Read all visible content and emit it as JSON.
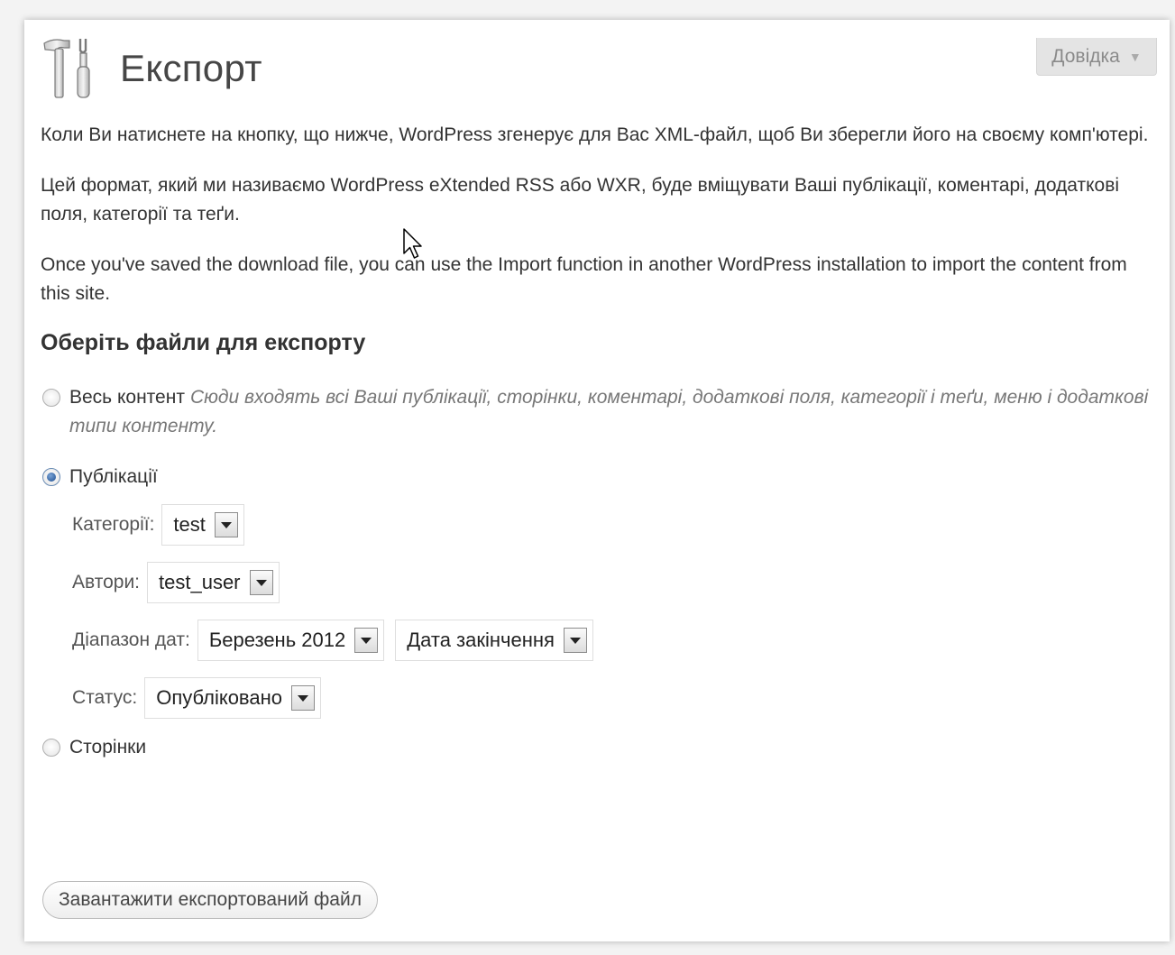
{
  "help_tab": {
    "label": "Довідка",
    "arrow": "▼"
  },
  "page": {
    "title": "Експорт",
    "icon": "tools-icon"
  },
  "intro": [
    "Коли Ви натиснете на кнопку, що нижче, WordPress згенерує для Вас XML-файл, щоб Ви зберегли його на своєму комп'ютері.",
    "Цей формат, який ми називаємо WordPress eXtended RSS або WXR, буде вміщувати Ваші публікації, коментарі, додаткові поля, категорії та теґи.",
    "Once you've saved the download file, you can use the Import function in another WordPress installation to import the content from this site."
  ],
  "section_title": "Оберіть файли для експорту",
  "options": {
    "all": {
      "label": "Весь контент",
      "description": "Сюди входять всі Ваші публікації, сторінки, коментарі, додаткові поля, категорії і теґи, меню і додаткові типи контенту.",
      "checked": false
    },
    "posts": {
      "label": "Публікації",
      "checked": true
    },
    "pages": {
      "label": "Сторінки",
      "checked": false
    }
  },
  "filters": {
    "categories": {
      "label": "Категорії:",
      "value": "test"
    },
    "authors": {
      "label": "Автори:",
      "value": "test_user"
    },
    "date_range": {
      "label": "Діапазон дат:",
      "start": "Березень 2012",
      "end": "Дата закінчення"
    },
    "status": {
      "label": "Статус:",
      "value": "Опубліковано"
    }
  },
  "submit": {
    "label": "Завантажити експортований файл"
  },
  "colors": {
    "background": "#f3f3f3",
    "panel": "#ffffff",
    "text": "#333333",
    "title": "#464646",
    "description": "#777777",
    "radio_accent": "#2a5a9a"
  }
}
